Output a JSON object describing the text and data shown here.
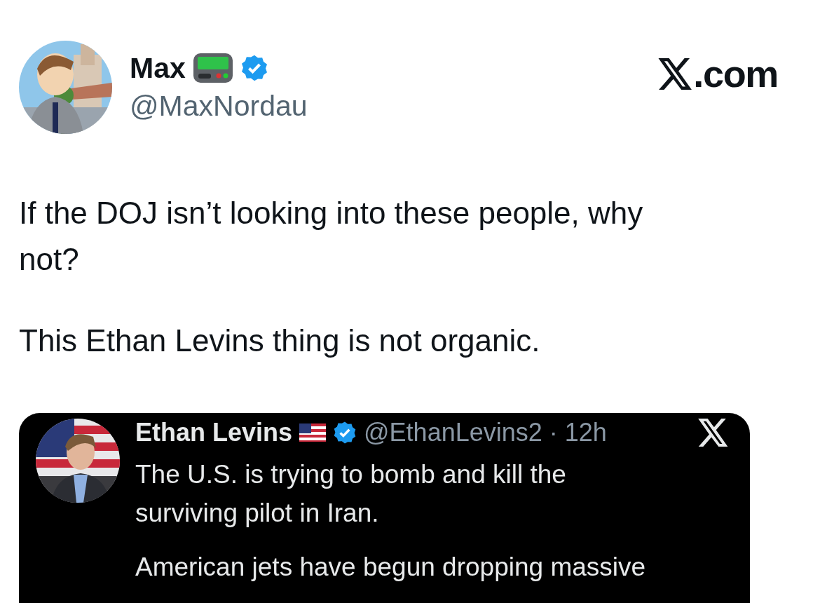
{
  "author": {
    "name": "Max",
    "handle": "@MaxNordau",
    "verified": true
  },
  "brand": {
    "suffix": ".com"
  },
  "body": [
    "If the DOJ isn’t looking into these people, why not?",
    "This Ethan Levins thing is not organic."
  ],
  "quoted_post": {
    "name": "Ethan Levins",
    "verified": true,
    "handle": "@EthanLevins2",
    "separator": "·",
    "time": "12h",
    "paragraphs": [
      "The U.S. is trying to bomb and kill the surviving pilot in Iran.",
      "American jets have begun dropping massive"
    ]
  }
}
